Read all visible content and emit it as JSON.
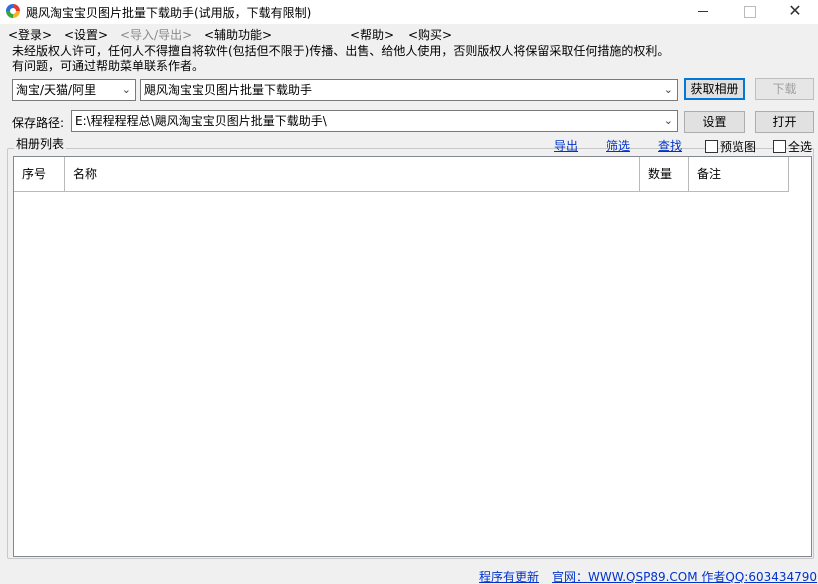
{
  "window": {
    "title": "飓风淘宝宝贝图片批量下载助手(试用版，下载有限制)",
    "minimize_label": "—",
    "maximize_label": "",
    "close_label": "✕"
  },
  "menu": {
    "items": [
      {
        "label": "<登录>",
        "enabled": true
      },
      {
        "label": "<设置>",
        "enabled": true
      },
      {
        "label": "<导入/导出>",
        "enabled": false
      },
      {
        "label": "<辅助功能>",
        "enabled": true
      },
      {
        "label": "<帮助>",
        "enabled": true
      },
      {
        "label": "<购买>",
        "enabled": true
      }
    ]
  },
  "notice": {
    "line1": "未经版权人许可，任何人不得擅自将软件(包括但不限于)传播、出售、给他人使用，否则版权人将保留采取任何措施的权利。",
    "line2": "有问题，可通过帮助菜单联系作者。"
  },
  "source": {
    "platform_value": "淘宝/天猫/阿里",
    "url_value": "飓风淘宝宝贝图片批量下载助手",
    "get_album_button": "获取相册",
    "download_button": "下载"
  },
  "save": {
    "label": "保存路径:",
    "path_value": "E:\\程程程程总\\飓风淘宝宝贝图片批量下载助手\\",
    "settings_button": "设置",
    "open_button": "打开"
  },
  "album": {
    "group_title": "相册列表",
    "export_link": "导出",
    "filter_link": "筛选",
    "find_link": "查找",
    "preview_label": "预览图",
    "select_all_label": "全选",
    "columns": [
      "序号",
      "名称",
      "数量",
      "备注"
    ],
    "rows": []
  },
  "status": {
    "update_link": "程序有更新",
    "website_link": "官网：WWW.QSP89.COM 作者QQ:603434790"
  },
  "icons": {
    "app": "app-logo-icon",
    "dropdown": "chevron-down-icon"
  }
}
